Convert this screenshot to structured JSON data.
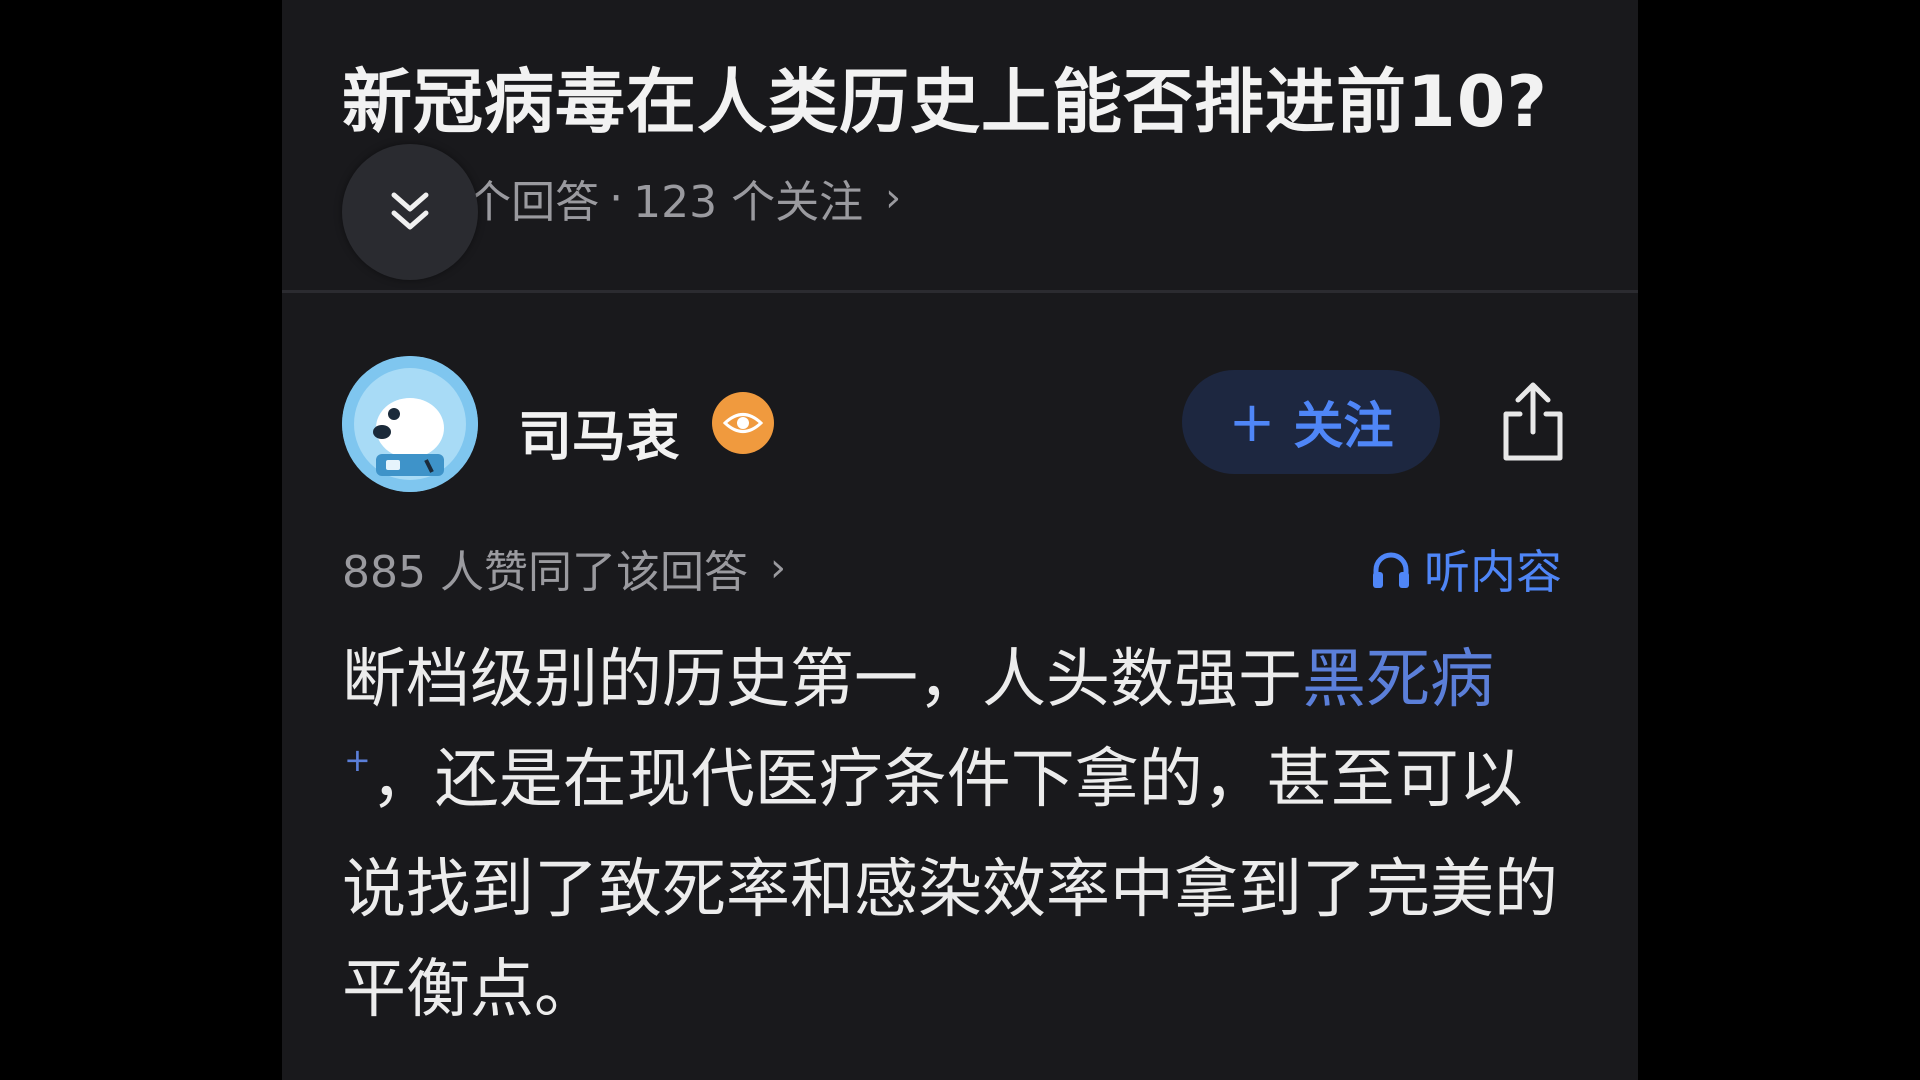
{
  "question": {
    "title": "新冠病毒在人类历史上能否排进前10?",
    "meta_prefix": "(",
    "answers": "56 个回答",
    "separator": "·",
    "follows": "123 个关注",
    "chevron": "›"
  },
  "author": {
    "name": "司马衷",
    "badge_icon": "eye-icon",
    "follow_plus": "+",
    "follow_label": "关注",
    "share_icon": "share-icon"
  },
  "answer": {
    "likes_text": "885 人赞同了该回答",
    "likes_chevron": "›",
    "listen_label": "听内容",
    "listen_icon": "headphones-icon",
    "body_part1": "断档级别的历史第一，人头数强于",
    "link_term": "黑死病",
    "link_mark": "+",
    "body_part2": "，还是在现代医疗条件下拿的，甚至可以说找到了致死率和感染效率中拿到了完美的平衡点。"
  },
  "colors": {
    "background": "#000000",
    "panel": "#19191c",
    "accent": "#4f86f7",
    "link": "#5b7fd9",
    "muted_text": "#9a9a9f",
    "badge": "#f09a3e"
  }
}
